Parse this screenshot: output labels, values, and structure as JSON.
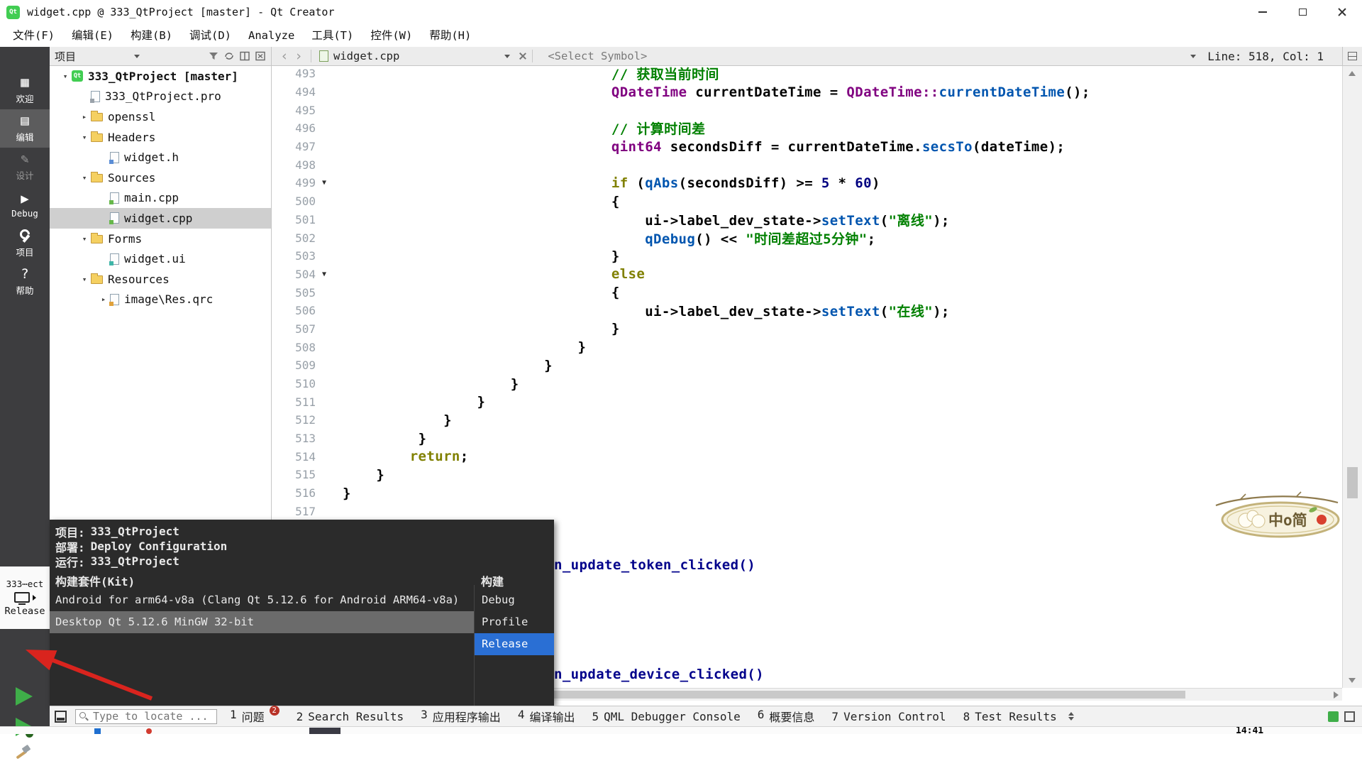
{
  "window": {
    "title": "widget.cpp @ 333_QtProject [master] - Qt Creator"
  },
  "menu": {
    "items": [
      "文件(F)",
      "编辑(E)",
      "构建(B)",
      "调试(D)",
      "Analyze",
      "工具(T)",
      "控件(W)",
      "帮助(H)"
    ]
  },
  "mode_bar": {
    "items": [
      {
        "label": "欢迎",
        "icon": "welcome-grid-icon",
        "glyph": "▦",
        "state": "normal"
      },
      {
        "label": "编辑",
        "icon": "edit-document-icon",
        "glyph": "▤",
        "state": "active"
      },
      {
        "label": "设计",
        "icon": "design-pencil-icon",
        "glyph": "✎",
        "state": "disabled"
      },
      {
        "label": "Debug",
        "icon": "debug-play-icon",
        "glyph": "▶",
        "state": "normal"
      },
      {
        "label": "项目",
        "icon": "projects-wrench-icon",
        "glyph": "",
        "state": "normal"
      },
      {
        "label": "帮助",
        "icon": "help-question-icon",
        "glyph": "?",
        "state": "normal"
      }
    ],
    "kit_button": {
      "project": "333⋯ect",
      "config": "Release"
    }
  },
  "project_panel": {
    "combo_label": "项目",
    "tree": [
      {
        "label": "333_QtProject [master]",
        "depth": 0,
        "arrow": "expanded",
        "icon": "qt-project-icon",
        "bold": true
      },
      {
        "label": "333_QtProject.pro",
        "depth": 1,
        "arrow": "",
        "icon": "pro-file-icon"
      },
      {
        "label": "openssl",
        "depth": 1,
        "arrow": "collapsed",
        "icon": "folder-icon"
      },
      {
        "label": "Headers",
        "depth": 1,
        "arrow": "expanded",
        "icon": "folder-icon"
      },
      {
        "label": "widget.h",
        "depth": 2,
        "arrow": "",
        "icon": "header-file-icon"
      },
      {
        "label": "Sources",
        "depth": 1,
        "arrow": "expanded",
        "icon": "folder-icon"
      },
      {
        "label": "main.cpp",
        "depth": 2,
        "arrow": "",
        "icon": "cpp-file-icon"
      },
      {
        "label": "widget.cpp",
        "depth": 2,
        "arrow": "",
        "icon": "cpp-file-icon",
        "selected": true
      },
      {
        "label": "Forms",
        "depth": 1,
        "arrow": "expanded",
        "icon": "folder-icon"
      },
      {
        "label": "widget.ui",
        "depth": 2,
        "arrow": "",
        "icon": "ui-file-icon"
      },
      {
        "label": "Resources",
        "depth": 1,
        "arrow": "expanded",
        "icon": "folder-icon"
      },
      {
        "label": "image\\Res.qrc",
        "depth": 2,
        "arrow": "collapsed",
        "icon": "qrc-file-icon"
      }
    ]
  },
  "editor": {
    "tab_label": "widget.cpp",
    "symbol_combo": "<Select Symbol>",
    "cursor_position": "Line: 518, Col: 1",
    "first_line": 493,
    "lines": [
      {
        "n": 493,
        "ind": 32,
        "t": [
          [
            "// 获取当前时间",
            "cm"
          ]
        ]
      },
      {
        "n": 494,
        "ind": 32,
        "t": [
          [
            "QDateTime",
            "ty"
          ],
          [
            " ",
            "pl"
          ],
          [
            "currentDateTime",
            "pl"
          ],
          [
            " = ",
            "pl"
          ],
          [
            "QDateTime::",
            "ty"
          ],
          [
            "currentDateTime",
            "fn"
          ],
          [
            "();",
            "pl"
          ]
        ]
      },
      {
        "n": 495,
        "ind": 0,
        "t": []
      },
      {
        "n": 496,
        "ind": 32,
        "t": [
          [
            "// 计算时间差",
            "cm"
          ]
        ]
      },
      {
        "n": 497,
        "ind": 32,
        "t": [
          [
            "qint64",
            "ty"
          ],
          [
            " ",
            "pl"
          ],
          [
            "secondsDiff",
            "pl"
          ],
          [
            " = ",
            "pl"
          ],
          [
            "currentDateTime",
            "pl"
          ],
          [
            ".",
            "pl"
          ],
          [
            "secsTo",
            "fn"
          ],
          [
            "(",
            "pl"
          ],
          [
            "dateTime",
            "pl"
          ],
          [
            ");",
            "pl"
          ]
        ]
      },
      {
        "n": 498,
        "ind": 0,
        "t": []
      },
      {
        "n": 499,
        "ind": 32,
        "fold": true,
        "t": [
          [
            "if",
            "kw"
          ],
          [
            " (",
            "pl"
          ],
          [
            "qAbs",
            "fn"
          ],
          [
            "(",
            "pl"
          ],
          [
            "secondsDiff",
            "pl"
          ],
          [
            ") >= ",
            "pl"
          ],
          [
            "5",
            "nu"
          ],
          [
            " * ",
            "pl"
          ],
          [
            "60",
            "nu"
          ],
          [
            ")",
            "pl"
          ]
        ]
      },
      {
        "n": 500,
        "ind": 32,
        "t": [
          [
            "{",
            "pl"
          ]
        ]
      },
      {
        "n": 501,
        "ind": 36,
        "t": [
          [
            "ui",
            "pl"
          ],
          [
            "->",
            "pl"
          ],
          [
            "label_dev_state",
            "pl"
          ],
          [
            "->",
            "pl"
          ],
          [
            "setText",
            "fn"
          ],
          [
            "(",
            "pl"
          ],
          [
            "\"离线\"",
            "st"
          ],
          [
            ");",
            "pl"
          ]
        ]
      },
      {
        "n": 502,
        "ind": 36,
        "t": [
          [
            "qDebug",
            "fn"
          ],
          [
            "() << ",
            "pl"
          ],
          [
            "\"时间差超过5分钟\"",
            "st"
          ],
          [
            ";",
            "pl"
          ]
        ]
      },
      {
        "n": 503,
        "ind": 32,
        "t": [
          [
            "}",
            "pl"
          ]
        ]
      },
      {
        "n": 504,
        "ind": 32,
        "fold": true,
        "t": [
          [
            "else",
            "kw"
          ]
        ]
      },
      {
        "n": 505,
        "ind": 32,
        "t": [
          [
            "{",
            "pl"
          ]
        ]
      },
      {
        "n": 506,
        "ind": 36,
        "t": [
          [
            "ui",
            "pl"
          ],
          [
            "->",
            "pl"
          ],
          [
            "label_dev_state",
            "pl"
          ],
          [
            "->",
            "pl"
          ],
          [
            "setText",
            "fn"
          ],
          [
            "(",
            "pl"
          ],
          [
            "\"在线\"",
            "st"
          ],
          [
            ");",
            "pl"
          ]
        ]
      },
      {
        "n": 507,
        "ind": 32,
        "t": [
          [
            "}",
            "pl"
          ]
        ]
      },
      {
        "n": 508,
        "ind": 28,
        "t": [
          [
            "}",
            "pl"
          ]
        ]
      },
      {
        "n": 509,
        "ind": 24,
        "t": [
          [
            "}",
            "pl"
          ]
        ]
      },
      {
        "n": 510,
        "ind": 20,
        "t": [
          [
            "}",
            "pl"
          ]
        ]
      },
      {
        "n": 511,
        "ind": 16,
        "t": [
          [
            "}",
            "pl"
          ]
        ]
      },
      {
        "n": 512,
        "ind": 12,
        "t": [
          [
            "}",
            "pl"
          ]
        ]
      },
      {
        "n": 513,
        "ind": 9,
        "t": [
          [
            "}",
            "pl"
          ]
        ]
      },
      {
        "n": 514,
        "ind": 8,
        "t": [
          [
            "return",
            "kw"
          ],
          [
            ";",
            "pl"
          ]
        ]
      },
      {
        "n": 515,
        "ind": 4,
        "t": [
          [
            "}",
            "pl"
          ]
        ]
      },
      {
        "n": 516,
        "ind": 0,
        "t": [
          [
            "}",
            "pl"
          ]
        ]
      },
      {
        "n": 517,
        "ind": 0,
        "t": []
      }
    ],
    "fragments": [
      {
        "text": "n_update_token_clicked()",
        "line": 520
      },
      {
        "text": "n_update_device_clicked()",
        "line": 526
      }
    ]
  },
  "kit_popup": {
    "info": [
      {
        "key": "项目:",
        "value": "333_QtProject"
      },
      {
        "key": "部署:",
        "value": "Deploy Configuration"
      },
      {
        "key": "运行:",
        "value": "333_QtProject"
      }
    ],
    "kit_header": "构建套件(Kit)",
    "build_header": "构建",
    "kits": [
      {
        "label": "Android for arm64-v8a (Clang Qt 5.12.6 for Android ARM64-v8a)",
        "selected": false
      },
      {
        "label": "Desktop Qt 5.12.6 MinGW 32-bit",
        "selected": true
      }
    ],
    "builds": [
      {
        "label": "Debug",
        "selected": false
      },
      {
        "label": "Profile",
        "selected": false
      },
      {
        "label": "Release",
        "selected": true
      }
    ]
  },
  "status_bar": {
    "locator_placeholder": "Type to locate ...",
    "panes": [
      {
        "num": "1",
        "label": "问题",
        "badge": "2"
      },
      {
        "num": "2",
        "label": "Search Results",
        "badge": ""
      },
      {
        "num": "3",
        "label": "应用程序输出",
        "badge": ""
      },
      {
        "num": "4",
        "label": "编译输出",
        "badge": ""
      },
      {
        "num": "5",
        "label": "QML Debugger Console",
        "badge": ""
      },
      {
        "num": "6",
        "label": "概要信息",
        "badge": ""
      },
      {
        "num": "7",
        "label": "Version Control",
        "badge": ""
      },
      {
        "num": "8",
        "label": "Test Results",
        "badge": ""
      }
    ]
  },
  "taskbar": {
    "clock": "14:41"
  },
  "watermark": {
    "text": "中o简"
  },
  "colors": {
    "accent_blue": "#2a6fd4",
    "kit_highlight": "#6b6b6b",
    "mode_bar_bg": "#3d3d3f",
    "popup_bg": "#2b2b2b",
    "selection_gray": "#cfcfcf",
    "run_green": "#3fae49",
    "arrow_red": "#d9241e",
    "syntax": {
      "comment": "#008000",
      "string": "#008000",
      "keyword": "#808000",
      "type": "#800080",
      "function": "#0055af",
      "number": "#000080",
      "plain": "#000000",
      "declaration": "#00008b"
    }
  }
}
